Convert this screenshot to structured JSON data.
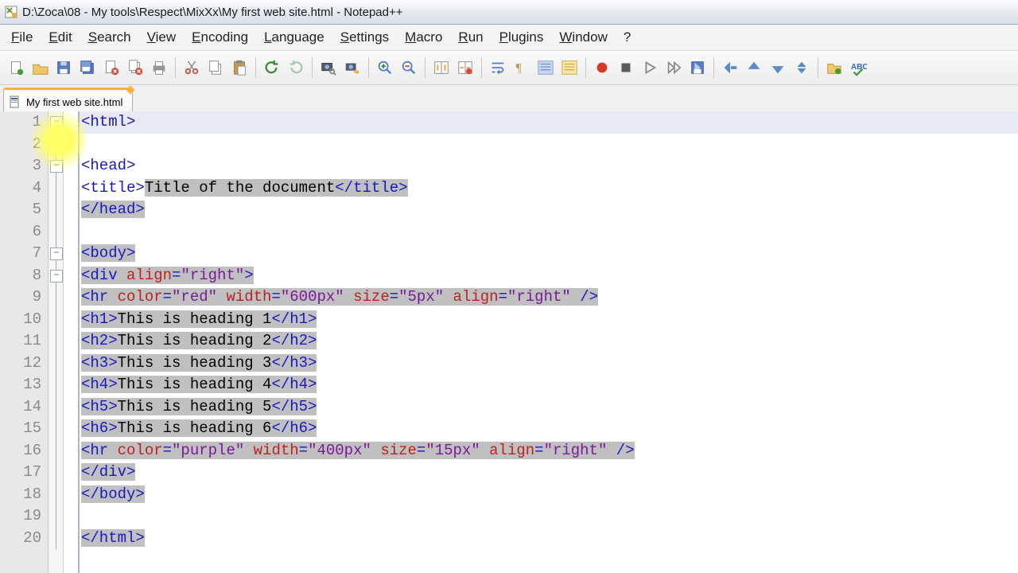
{
  "title": "D:\\Zoca\\08 - My tools\\Respect\\MixXx\\My first web site.html - Notepad++",
  "menu": [
    "File",
    "Edit",
    "Search",
    "View",
    "Encoding",
    "Language",
    "Settings",
    "Macro",
    "Run",
    "Plugins",
    "Window",
    "?"
  ],
  "tab": {
    "label": "My first web site.html"
  },
  "toolbar_icons": [
    "new-file-icon",
    "open-file-icon",
    "save-icon",
    "save-all-icon",
    "close-icon",
    "close-all-icon",
    "print-icon",
    "sep",
    "cut-icon",
    "copy-icon",
    "paste-icon",
    "sep",
    "undo-icon",
    "redo-icon",
    "sep",
    "find-icon",
    "replace-icon",
    "sep",
    "zoom-in-icon",
    "zoom-out-icon",
    "sep",
    "sync-v-icon",
    "sync-h-icon",
    "sep",
    "wordwrap-icon",
    "all-chars-icon",
    "indent-guide-icon",
    "lang-icon",
    "sep",
    "record-icon",
    "stop-icon",
    "play-icon",
    "play-multi-icon",
    "save-macro-icon",
    "sep",
    "outdent-icon",
    "up-icon",
    "down-icon",
    "sort-icon",
    "sep",
    "folder-icon",
    "spellcheck-icon"
  ],
  "code": {
    "lines": [
      {
        "n": 1,
        "fold": "minus",
        "seg": [
          [
            "tag",
            "<html>"
          ]
        ],
        "current": true,
        "selFrom": 0
      },
      {
        "n": 2,
        "seg": [
          [
            "txt",
            ""
          ]
        ]
      },
      {
        "n": 3,
        "fold": "minus",
        "seg": [
          [
            "tag",
            "<head>"
          ]
        ]
      },
      {
        "n": 4,
        "seg": [
          [
            "tag",
            "<title>"
          ],
          [
            "sel-txt",
            "Title of the document"
          ],
          [
            "sel-tag",
            "</title>"
          ]
        ]
      },
      {
        "n": 5,
        "seg": [
          [
            "sel-tag",
            "</head>"
          ]
        ]
      },
      {
        "n": 6,
        "seg": [
          [
            "txt",
            ""
          ]
        ]
      },
      {
        "n": 7,
        "fold": "minus",
        "seg": [
          [
            "sel-tag",
            "<body>"
          ]
        ]
      },
      {
        "n": 8,
        "fold": "minus",
        "seg": [
          [
            "sel-tag",
            "<div "
          ],
          [
            "sel-attr",
            "align"
          ],
          [
            "sel-tag",
            "="
          ],
          [
            "sel-str",
            "\"right\""
          ],
          [
            "sel-tag",
            ">"
          ]
        ]
      },
      {
        "n": 9,
        "seg": [
          [
            "sel-tag",
            "<hr "
          ],
          [
            "sel-attr",
            "color"
          ],
          [
            "sel-tag",
            "="
          ],
          [
            "sel-str",
            "\"red\""
          ],
          [
            "sel-tag",
            " "
          ],
          [
            "sel-attr",
            "width"
          ],
          [
            "sel-tag",
            "="
          ],
          [
            "sel-str",
            "\"600px\""
          ],
          [
            "sel-tag",
            " "
          ],
          [
            "sel-attr",
            "size"
          ],
          [
            "sel-tag",
            "="
          ],
          [
            "sel-str",
            "\"5px\""
          ],
          [
            "sel-tag",
            " "
          ],
          [
            "sel-attr",
            "align"
          ],
          [
            "sel-tag",
            "="
          ],
          [
            "sel-str",
            "\"right\""
          ],
          [
            "sel-tag",
            " />"
          ]
        ]
      },
      {
        "n": 10,
        "seg": [
          [
            "sel-tag",
            "<h1>"
          ],
          [
            "sel-txt",
            "This is heading 1"
          ],
          [
            "sel-tag",
            "</h1>"
          ]
        ]
      },
      {
        "n": 11,
        "seg": [
          [
            "sel-tag",
            "<h2>"
          ],
          [
            "sel-txt",
            "This is heading 2"
          ],
          [
            "sel-tag",
            "</h2>"
          ]
        ]
      },
      {
        "n": 12,
        "seg": [
          [
            "sel-tag",
            "<h3>"
          ],
          [
            "sel-txt",
            "This is heading 3"
          ],
          [
            "sel-tag",
            "</h3>"
          ]
        ]
      },
      {
        "n": 13,
        "seg": [
          [
            "sel-tag",
            "<h4>"
          ],
          [
            "sel-txt",
            "This is heading 4"
          ],
          [
            "sel-tag",
            "</h4>"
          ]
        ]
      },
      {
        "n": 14,
        "seg": [
          [
            "sel-tag",
            "<h5>"
          ],
          [
            "sel-txt",
            "This is heading 5"
          ],
          [
            "sel-tag",
            "</h5>"
          ]
        ]
      },
      {
        "n": 15,
        "seg": [
          [
            "sel-tag",
            "<h6>"
          ],
          [
            "sel-txt",
            "This is heading 6"
          ],
          [
            "sel-tag",
            "</h6>"
          ]
        ]
      },
      {
        "n": 16,
        "seg": [
          [
            "sel-tag",
            "<hr "
          ],
          [
            "sel-attr",
            "color"
          ],
          [
            "sel-tag",
            "="
          ],
          [
            "sel-str",
            "\"purple\""
          ],
          [
            "sel-tag",
            " "
          ],
          [
            "sel-attr",
            "width"
          ],
          [
            "sel-tag",
            "="
          ],
          [
            "sel-str",
            "\"400px\""
          ],
          [
            "sel-tag",
            " "
          ],
          [
            "sel-attr",
            "size"
          ],
          [
            "sel-tag",
            "="
          ],
          [
            "sel-str",
            "\"15px\""
          ],
          [
            "sel-tag",
            " "
          ],
          [
            "sel-attr",
            "align"
          ],
          [
            "sel-tag",
            "="
          ],
          [
            "sel-str",
            "\"right\""
          ],
          [
            "sel-tag",
            " />"
          ]
        ]
      },
      {
        "n": 17,
        "seg": [
          [
            "sel-tag",
            "</div>"
          ]
        ]
      },
      {
        "n": 18,
        "seg": [
          [
            "sel-tag",
            "</body>"
          ]
        ]
      },
      {
        "n": 19,
        "seg": [
          [
            "txt",
            ""
          ]
        ]
      },
      {
        "n": 20,
        "seg": [
          [
            "sel-tag",
            "</html>"
          ]
        ]
      }
    ]
  }
}
